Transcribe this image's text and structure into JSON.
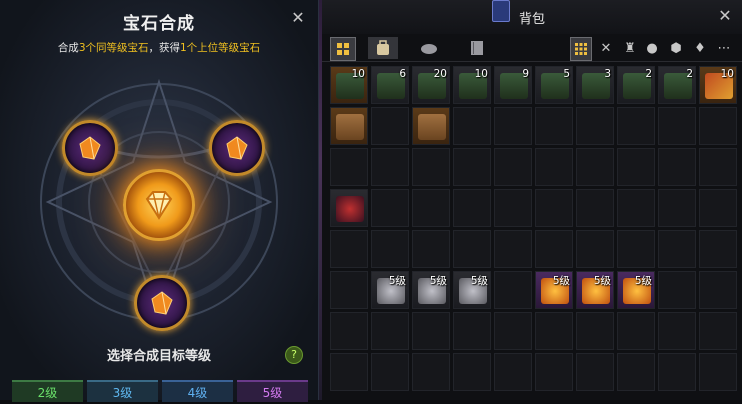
{
  "left_panel": {
    "title": "宝石合成",
    "close": "✕",
    "sub_pre": "合成",
    "sub_hl1": "3个同等级宝石",
    "sub_mid": "，获得",
    "sub_hl2": "1个上位等级宝石",
    "prompt": "选择合成目标等级",
    "help": "?",
    "levels": [
      "2级",
      "3级",
      "4级",
      "5级"
    ]
  },
  "right_panel": {
    "title": "背包",
    "close": "✕"
  },
  "inventory_rows": [
    [
      {
        "count": "10",
        "style": "brown",
        "icon": "chest-icon"
      },
      {
        "count": "6",
        "style": "dark",
        "icon": "chest-icon"
      },
      {
        "count": "20",
        "style": "dark",
        "icon": "chest-icon"
      },
      {
        "count": "10",
        "style": "dark",
        "icon": "chest-icon"
      },
      {
        "count": "9",
        "style": "dark",
        "icon": "chest-icon"
      },
      {
        "count": "5",
        "style": "dark",
        "icon": "chest-icon"
      },
      {
        "count": "3",
        "style": "dark",
        "icon": "chest-icon"
      },
      {
        "count": "2",
        "style": "dark",
        "icon": "chest-icon"
      },
      {
        "count": "2",
        "style": "dark",
        "icon": "chest-icon"
      },
      {
        "count": "10",
        "style": "brown",
        "icon": "book-icon"
      }
    ],
    [
      {
        "count": "",
        "style": "brown",
        "icon": "box-icon"
      },
      {
        "count": "",
        "style": "",
        "icon": ""
      },
      {
        "count": "",
        "style": "brown",
        "icon": "box-icon"
      }
    ],
    [],
    [
      {
        "count": "",
        "style": "dark",
        "icon": "rune-icon"
      }
    ],
    [],
    [
      {
        "count": "",
        "style": "",
        "icon": ""
      },
      {
        "count": "5级",
        "style": "dark",
        "icon": "gem-grey-icon"
      },
      {
        "count": "5级",
        "style": "dark",
        "icon": "gem-grey-icon"
      },
      {
        "count": "5级",
        "style": "dark",
        "icon": "gem-grey-icon"
      },
      {
        "count": "",
        "style": "",
        "icon": ""
      },
      {
        "count": "5级",
        "style": "purple",
        "icon": "gem-orange-icon"
      },
      {
        "count": "5级",
        "style": "purple",
        "icon": "gem-orange-icon"
      },
      {
        "count": "5级",
        "style": "purple",
        "icon": "gem-orange-icon"
      }
    ]
  ],
  "colors": {
    "accent_gold": "#f0c020",
    "level_green": "#6ae06a",
    "level_blue": "#5fb8f0",
    "level_purple": "#d37af0"
  }
}
